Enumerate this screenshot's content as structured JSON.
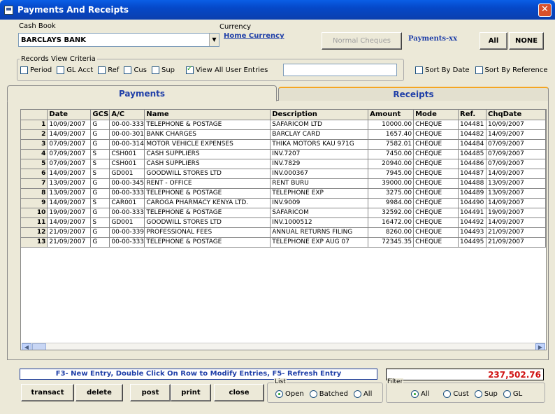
{
  "window": {
    "title": "Payments And Receipts",
    "close": "✕"
  },
  "cashbook": {
    "label": "Cash Book",
    "value": "BARCLAYS BANK"
  },
  "currency": {
    "label": "Currency",
    "value": "Home Currency"
  },
  "buttons": {
    "normal_cheques": "Normal Cheques",
    "payments_xx": "Payments-xx",
    "all": "All",
    "none": "NONE"
  },
  "criteria": {
    "legend": "Records View Criteria",
    "period": "Period",
    "gl_acct": "GL Acct",
    "ref": "Ref",
    "cus": "Cus",
    "sup": "Sup",
    "view_all": "View All User Entries"
  },
  "sort": {
    "by_date": "Sort By Date",
    "by_reference": "Sort By Reference"
  },
  "tabs": {
    "payments": "Payments",
    "receipts": "Receipts"
  },
  "table": {
    "columns": [
      "",
      "Date",
      "GCS",
      "A/C",
      "Name",
      "Description",
      "Amount",
      "Mode",
      "Ref.",
      "ChqDate"
    ],
    "rows": [
      [
        "1",
        "10/09/2007",
        "G",
        "00-00-333",
        "TELEPHONE & POSTAGE",
        "SAFARICOM LTD",
        "10000.00",
        "CHEQUE",
        "104481",
        "10/09/2007"
      ],
      [
        "2",
        "14/09/2007",
        "G",
        "00-00-301",
        "BANK CHARGES",
        "BARCLAY CARD",
        "1657.40",
        "CHEQUE",
        "104482",
        "14/09/2007"
      ],
      [
        "3",
        "07/09/2007",
        "G",
        "00-00-314",
        "MOTOR VEHICLE EXPENSES",
        "THIKA MOTORS KAU 971G",
        "7582.01",
        "CHEQUE",
        "104484",
        "07/09/2007"
      ],
      [
        "4",
        "07/09/2007",
        "S",
        "CSH001",
        "CASH SUPPLIERS",
        "INV.7207",
        "7450.00",
        "CHEQUE",
        "104485",
        "07/09/2007"
      ],
      [
        "5",
        "07/09/2007",
        "S",
        "CSH001",
        "CASH SUPPLIERS",
        "INV.7829",
        "20940.00",
        "CHEQUE",
        "104486",
        "07/09/2007"
      ],
      [
        "6",
        "14/09/2007",
        "S",
        "GD001",
        "GOODWILL STORES LTD",
        "INV.000367",
        "7945.00",
        "CHEQUE",
        "104487",
        "14/09/2007"
      ],
      [
        "7",
        "13/09/2007",
        "G",
        "00-00-345",
        "RENT - OFFICE",
        "RENT BURU",
        "39000.00",
        "CHEQUE",
        "104488",
        "13/09/2007"
      ],
      [
        "8",
        "13/09/2007",
        "G",
        "00-00-333",
        "TELEPHONE & POSTAGE",
        "TELEPHONE EXP",
        "3275.00",
        "CHEQUE",
        "104489",
        "13/09/2007"
      ],
      [
        "9",
        "14/09/2007",
        "S",
        "CAR001",
        "CAROGA PHARMACY KENYA LTD.",
        "INV.9009",
        "9984.00",
        "CHEQUE",
        "104490",
        "14/09/2007"
      ],
      [
        "10",
        "19/09/2007",
        "G",
        "00-00-333",
        "TELEPHONE & POSTAGE",
        "SAFARICOM",
        "32592.00",
        "CHEQUE",
        "104491",
        "19/09/2007"
      ],
      [
        "11",
        "14/09/2007",
        "S",
        "GD001",
        "GOODWILL STORES LTD",
        "INV.1000512",
        "16472.00",
        "CHEQUE",
        "104492",
        "14/09/2007"
      ],
      [
        "12",
        "21/09/2007",
        "G",
        "00-00-339",
        "PROFESSIONAL FEES",
        "ANNUAL RETURNS FILING",
        "8260.00",
        "CHEQUE",
        "104493",
        "21/09/2007"
      ],
      [
        "13",
        "21/09/2007",
        "G",
        "00-00-333",
        "TELEPHONE & POSTAGE",
        "TELEPHONE EXP AUG 07",
        "72345.35",
        "CHEQUE",
        "104495",
        "21/09/2007"
      ]
    ]
  },
  "status": {
    "hint": "F3- New Entry,  Double Click On Row to Modify Entries, F5- Refresh Entry",
    "total": "237,502.76"
  },
  "actions": {
    "transact": "transact",
    "delete": "delete",
    "post": "post",
    "print": "print",
    "close": "close"
  },
  "list": {
    "legend": "List",
    "open": "Open",
    "batched": "Batched",
    "all": "All"
  },
  "filter": {
    "legend": "Filter",
    "all": "All",
    "cust": "Cust",
    "sup": "Sup",
    "gl": "GL"
  }
}
